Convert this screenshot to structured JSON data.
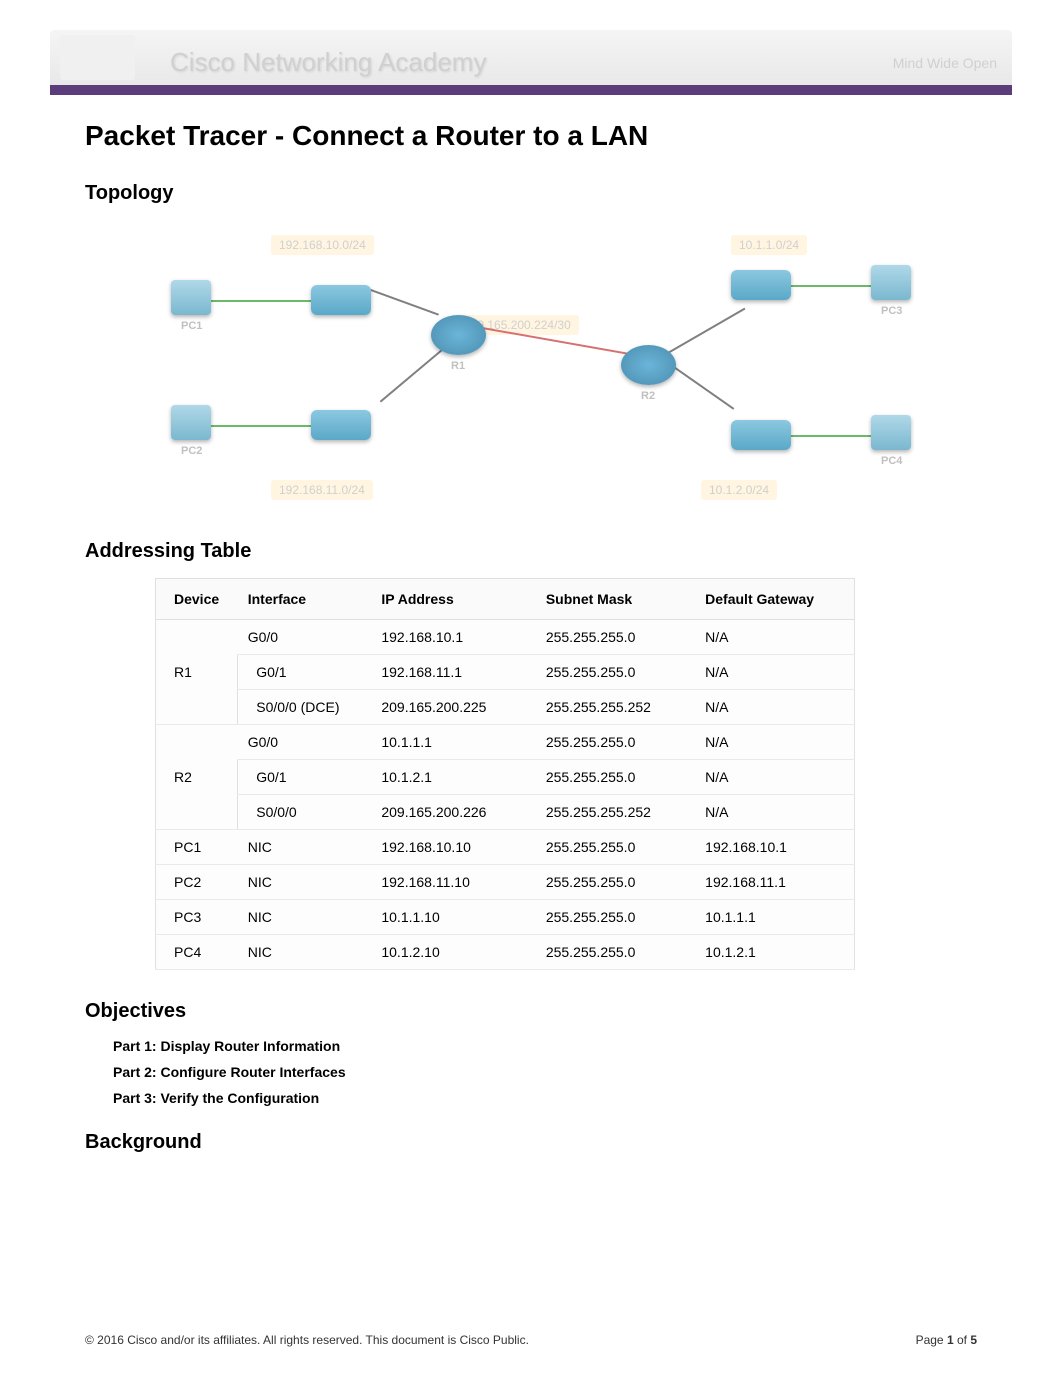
{
  "banner": {
    "title": "Cisco Networking Academy",
    "right": "Mind Wide Open"
  },
  "page_title": "Packet Tracer - Connect a Router to a LAN",
  "sections": {
    "topology": "Topology",
    "addressing": "Addressing Table",
    "objectives": "Objectives",
    "background": "Background"
  },
  "topology": {
    "net_labels": {
      "tl": "192.168.10.0/24",
      "tr": "10.1.1.0/24",
      "mid": "209.165.200.224/30",
      "bl": "192.168.11.0/24",
      "br": "10.1.2.0/24"
    },
    "devices": {
      "r1": "R1",
      "r2": "R2",
      "pc1": "PC1",
      "pc2": "PC2",
      "pc3": "PC3",
      "pc4": "PC4"
    }
  },
  "table": {
    "headers": {
      "device": "Device",
      "interface": "Interface",
      "ip": "IP Address",
      "mask": "Subnet Mask",
      "gateway": "Default Gateway"
    },
    "rows": [
      {
        "device": "R1",
        "rowspan": 3,
        "interface": "G0/0",
        "ip": "192.168.10.1",
        "mask": "255.255.255.0",
        "gateway": "N/A"
      },
      {
        "device": "",
        "rowspan": 0,
        "interface": "G0/1",
        "ip": "192.168.11.1",
        "mask": "255.255.255.0",
        "gateway": "N/A"
      },
      {
        "device": "",
        "rowspan": 0,
        "interface": "S0/0/0 (DCE)",
        "ip": "209.165.200.225",
        "mask": "255.255.255.252",
        "gateway": "N/A"
      },
      {
        "device": "R2",
        "rowspan": 3,
        "interface": "G0/0",
        "ip": "10.1.1.1",
        "mask": "255.255.255.0",
        "gateway": "N/A"
      },
      {
        "device": "",
        "rowspan": 0,
        "interface": "G0/1",
        "ip": "10.1.2.1",
        "mask": "255.255.255.0",
        "gateway": "N/A"
      },
      {
        "device": "",
        "rowspan": 0,
        "interface": "S0/0/0",
        "ip": "209.165.200.226",
        "mask": "255.255.255.252",
        "gateway": "N/A"
      },
      {
        "device": "PC1",
        "rowspan": 1,
        "interface": "NIC",
        "ip": "192.168.10.10",
        "mask": "255.255.255.0",
        "gateway": "192.168.10.1"
      },
      {
        "device": "PC2",
        "rowspan": 1,
        "interface": "NIC",
        "ip": "192.168.11.10",
        "mask": "255.255.255.0",
        "gateway": "192.168.11.1"
      },
      {
        "device": "PC3",
        "rowspan": 1,
        "interface": "NIC",
        "ip": "10.1.1.10",
        "mask": "255.255.255.0",
        "gateway": "10.1.1.1"
      },
      {
        "device": "PC4",
        "rowspan": 1,
        "interface": "NIC",
        "ip": "10.1.2.10",
        "mask": "255.255.255.0",
        "gateway": "10.1.2.1"
      }
    ]
  },
  "objectives": [
    "Part 1: Display Router Information",
    "Part 2: Configure Router Interfaces",
    "Part 3: Verify the Configuration"
  ],
  "footer": {
    "copyright": "© 2016 Cisco and/or its affiliates. All rights reserved. This document is Cisco Public.",
    "page_label": "Page ",
    "page_current": "1",
    "page_of": " of ",
    "page_total": "5"
  }
}
